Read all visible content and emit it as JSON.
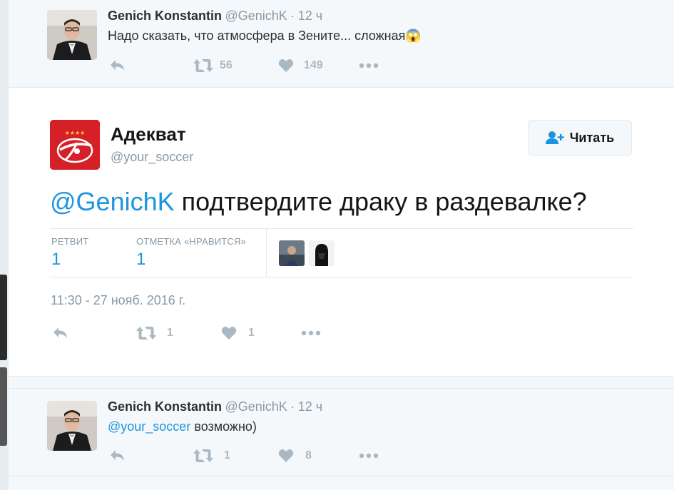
{
  "tweet_top": {
    "name": "Genich Konstantin",
    "handle": "@GenichK",
    "sep": "·",
    "time": "12 ч",
    "text": "Надо сказать, что атмосфера в Зените... сложная",
    "emoji": "😱",
    "retweets": "56",
    "likes": "149"
  },
  "tweet_main": {
    "name": "Адекват",
    "handle": "@your_soccer",
    "follow_label": "Читать",
    "mention": "@GenichK",
    "text": " подтвердите драку в раздевалке?",
    "retweet_label": "РЕТВИТ",
    "retweet_count": "1",
    "like_label": "ОТМЕТКА «НРАВИТСЯ»",
    "like_count": "1",
    "date": "11:30 - 27 нояб. 2016 г.",
    "action_retweets": "1",
    "action_likes": "1"
  },
  "tweet_reply": {
    "name": "Genich Konstantin",
    "handle": "@GenichK",
    "sep": "·",
    "time": "12 ч",
    "mention": "@your_soccer",
    "text": " возможно)",
    "retweets": "1",
    "likes": "8"
  },
  "icons": {
    "reply": "reply-icon",
    "retweet": "retweet-icon",
    "like": "heart-icon",
    "more": "more-icon",
    "follow": "follow-icon"
  },
  "colors": {
    "link": "#1b95e0",
    "muted": "#8899a6",
    "action": "#aab8c2",
    "brand_red": "#d62027"
  }
}
